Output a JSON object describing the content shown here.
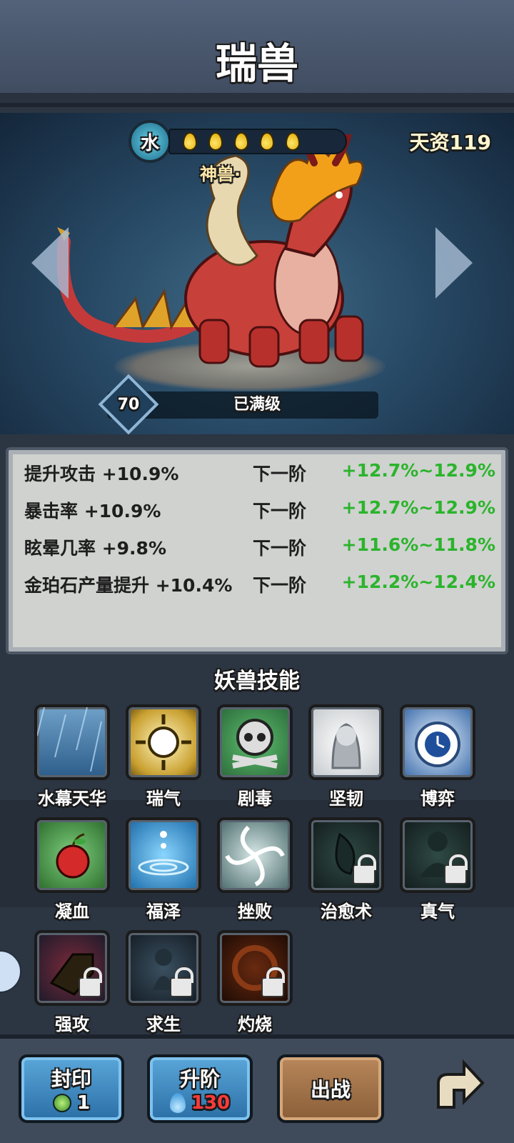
{
  "header": {
    "title": "瑞兽"
  },
  "beast": {
    "element": "水",
    "element_color": "#1a6a8a",
    "stars": 5,
    "talent": "天资119",
    "rank": "神兽·",
    "level": "70",
    "level_status": "已满级"
  },
  "stats": [
    {
      "label": "提升攻击 +10.9%",
      "next": "下一阶",
      "value": "+12.7%~12.9%"
    },
    {
      "label": "暴击率 +10.9%",
      "next": "下一阶",
      "value": "+12.7%~12.9%"
    },
    {
      "label": "眩晕几率 +9.8%",
      "next": "下一阶",
      "value": "+11.6%~11.8%"
    },
    {
      "label": "金珀石产量提升 +10.4%",
      "next": "下一阶",
      "value": "+12.2%~12.4%"
    }
  ],
  "skills_title": "妖兽技能",
  "skills": [
    {
      "name": "水幕天华",
      "icon": "rain-icon",
      "locked": false
    },
    {
      "name": "瑞气",
      "icon": "sun-icon",
      "locked": false
    },
    {
      "name": "剧毒",
      "icon": "skull-icon",
      "locked": false
    },
    {
      "name": "坚韧",
      "icon": "figure-icon",
      "locked": false
    },
    {
      "name": "博弈",
      "icon": "clock-icon",
      "locked": false
    },
    {
      "name": "凝血",
      "icon": "apple-icon",
      "locked": false
    },
    {
      "name": "福泽",
      "icon": "water-ripple-icon",
      "locked": false
    },
    {
      "name": "挫败",
      "icon": "vortex-icon",
      "locked": false
    },
    {
      "name": "治愈术",
      "icon": "leaf-icon",
      "locked": true
    },
    {
      "name": "真气",
      "icon": "meditate-icon",
      "locked": true
    },
    {
      "name": "强攻",
      "icon": "fist-icon",
      "locked": true
    },
    {
      "name": "求生",
      "icon": "ghost-icon",
      "locked": true
    },
    {
      "name": "灼烧",
      "icon": "fire-icon",
      "locked": true
    }
  ],
  "buttons": {
    "seal": {
      "label": "封印",
      "count": "1"
    },
    "upgrade": {
      "label": "升阶",
      "cost": "130"
    },
    "battle": {
      "label": "出战"
    }
  }
}
